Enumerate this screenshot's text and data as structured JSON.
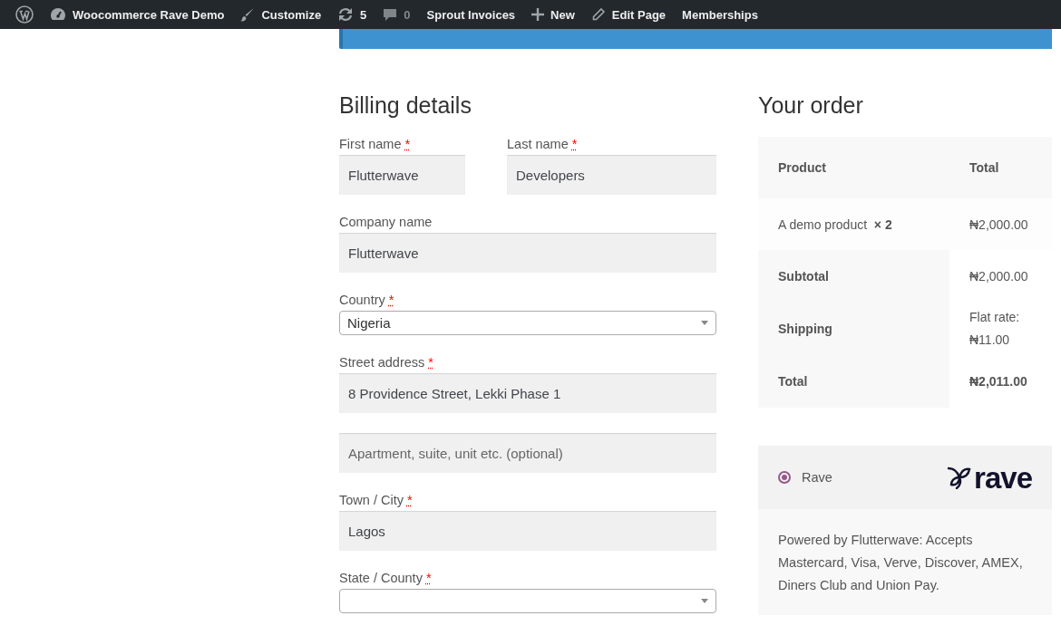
{
  "admin_bar": {
    "items": [
      {
        "kind": "wordpress",
        "muted": false
      },
      {
        "kind": "dashboard",
        "label": "Woocommerce Rave Demo",
        "muted": false
      },
      {
        "kind": "brush",
        "label": "Customize",
        "muted": false
      },
      {
        "kind": "updates",
        "label": "5",
        "muted": false
      },
      {
        "kind": "comments",
        "label": "0",
        "muted": true
      },
      {
        "kind": "text",
        "label": "Sprout Invoices",
        "muted": false
      },
      {
        "kind": "plus",
        "label": "New",
        "muted": false
      },
      {
        "kind": "pencil",
        "label": "Edit Page",
        "muted": false
      },
      {
        "kind": "text",
        "label": "Memberships",
        "muted": false
      }
    ]
  },
  "billing": {
    "title": "Billing details",
    "rows": [
      {
        "fields": [
          {
            "kind": "input",
            "label": "First name",
            "required_mark": "*",
            "value": "Flutterwave"
          },
          {
            "kind": "input",
            "label": "Last name",
            "required_mark": "*",
            "value": "Developers"
          }
        ]
      },
      {
        "fields": [
          {
            "kind": "input",
            "label": "Company name",
            "value": "Flutterwave"
          }
        ]
      },
      {
        "fields": [
          {
            "kind": "select",
            "label": "Country",
            "required_mark": "*",
            "value": "Nigeria"
          }
        ]
      },
      {
        "fields": [
          {
            "kind": "input",
            "label": "Street address",
            "required_mark": "*",
            "value": "8 Providence Street, Lekki Phase 1"
          }
        ]
      },
      {
        "fields": [
          {
            "kind": "input",
            "placeholder": "Apartment, suite, unit etc. (optional)"
          }
        ]
      },
      {
        "fields": [
          {
            "kind": "input",
            "label": "Town / City",
            "required_mark": "*",
            "value": "Lagos"
          }
        ]
      },
      {
        "fields": [
          {
            "kind": "select",
            "label": "State / County",
            "required_mark": "*"
          }
        ]
      }
    ]
  },
  "order": {
    "title": "Your order",
    "columns": [
      "Product",
      "Total"
    ],
    "items": [
      {
        "name": "A demo product",
        "quantity": "× 2",
        "total": "₦2,000.00"
      }
    ],
    "totals": [
      {
        "label": "Subtotal",
        "value": "₦2,000.00",
        "strong": false
      },
      {
        "label": "Shipping",
        "value": "Flat rate: ₦11.00",
        "strong": false
      },
      {
        "label": "Total",
        "value": "₦2,011.00",
        "strong": true
      }
    ]
  },
  "payment": {
    "methods": [
      {
        "label": "Rave",
        "selected": true,
        "logo_text": "rave",
        "description": "Powered by Flutterwave: Accepts Mastercard, Visa, Verve, Discover, AMEX, Diners Club and Union Pay."
      }
    ]
  }
}
